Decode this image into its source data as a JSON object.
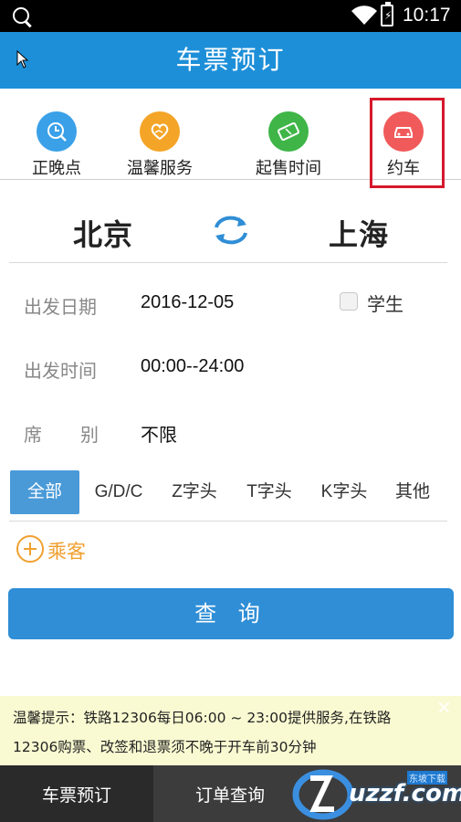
{
  "status_bar": {
    "time": "10:17"
  },
  "header": {
    "title": "车票预订"
  },
  "quick_tabs": [
    {
      "label": "正晚点",
      "icon": "clock-search-icon",
      "color": "#3aa0e8"
    },
    {
      "label": "温馨服务",
      "icon": "heart-hand-icon",
      "color": "#f4a528"
    },
    {
      "label": "起售时间",
      "icon": "ticket-icon",
      "color": "#3fb548"
    },
    {
      "label": "约车",
      "icon": "car-icon",
      "color": "#f05a5a"
    }
  ],
  "route": {
    "from": "北京",
    "to": "上海"
  },
  "form": {
    "date_label": "出发日期",
    "date_value": "2016-12-05",
    "student_label": "学生",
    "time_label": "出发时间",
    "time_value": "00:00--24:00",
    "seat_label_1": "席",
    "seat_label_2": "别",
    "seat_value": "不限"
  },
  "train_types": [
    "全部",
    "G/D/C",
    "Z字头",
    "T字头",
    "K字头",
    "其他"
  ],
  "passenger": {
    "label": "乘客"
  },
  "search_button": "查 询",
  "notice": {
    "line1": "温馨提示：铁路12306每日06:00 ~ 23:00提供服务,在铁路",
    "line2": "12306购票、改签和退票须不晚于开车前30分钟",
    "close": "×"
  },
  "bottom_nav": [
    "车票预订",
    "订单查询"
  ],
  "watermark": {
    "text": "uzzf.com",
    "small": "东坡下载"
  }
}
